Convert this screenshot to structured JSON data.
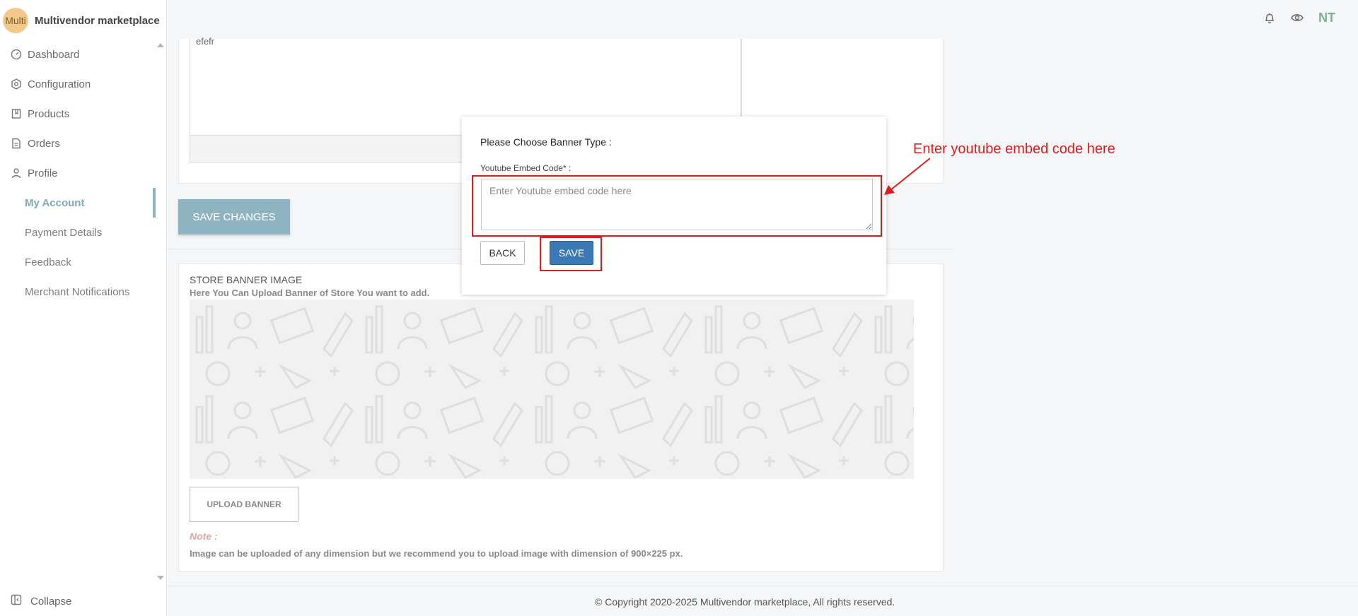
{
  "app": {
    "logo_text": "Multi",
    "name": "Multivendor marketplace"
  },
  "sidebar": {
    "items": [
      {
        "label": "Dashboard",
        "icon": "dashboard-icon"
      },
      {
        "label": "Configuration",
        "icon": "hexagon-gear-icon"
      },
      {
        "label": "Products",
        "icon": "book-icon"
      },
      {
        "label": "Orders",
        "icon": "document-icon"
      },
      {
        "label": "Profile",
        "icon": "user-icon"
      }
    ],
    "sub_items": [
      {
        "label": "My Account",
        "active": true
      },
      {
        "label": "Payment Details",
        "active": false
      },
      {
        "label": "Feedback",
        "active": false
      },
      {
        "label": "Merchant Notifications",
        "active": false
      }
    ],
    "collapse_label": "Collapse"
  },
  "header": {
    "initials": "NT",
    "icons": [
      "bell-icon",
      "eye-icon"
    ]
  },
  "editor": {
    "text": "efefr"
  },
  "save_changes_label": "SAVE CHANGES",
  "store_banner": {
    "title": "STORE BANNER IMAGE",
    "subtitle": "Here You Can Upload Banner of Store You want to add.",
    "upload_label": "UPLOAD BANNER",
    "note_label": "Note :",
    "note_text": "Image can be uploaded of any dimension but we recommend you to upload image with dimension of 900×225 px."
  },
  "footer": {
    "text": "© Copyright 2020-2025 Multivendor marketplace, All rights reserved."
  },
  "modal": {
    "title": "Please Choose Banner Type :",
    "field_label": "Youtube Embed Code* :",
    "placeholder": "Enter Youtube embed code here",
    "value": "",
    "back_label": "BACK",
    "save_label": "SAVE"
  },
  "annotation": {
    "text": "Enter youtube embed code here",
    "color": "#e01b1b"
  },
  "colors": {
    "accent": "#8fb4c1",
    "primary_button": "#3a79b6",
    "initials": "#7cb38f"
  }
}
